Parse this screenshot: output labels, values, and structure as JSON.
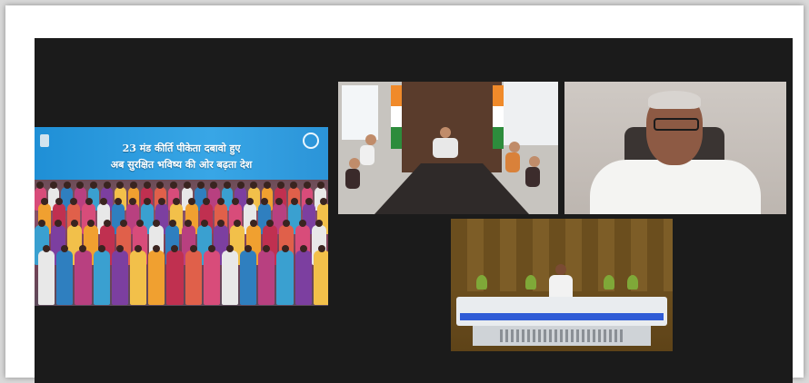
{
  "window": {
    "stage_bg": "#1b1b1b"
  },
  "tiles": [
    {
      "id": "tile-1",
      "banner": {
        "line1": "23 मंड कीर्ति पीकेता दबावो हुए",
        "line2": "अब सुरक्षित भविष्य की ओर बढ़ता देश",
        "color": "#2b96d9"
      }
    },
    {
      "id": "tile-2"
    },
    {
      "id": "tile-3"
    },
    {
      "id": "tile-4"
    }
  ]
}
